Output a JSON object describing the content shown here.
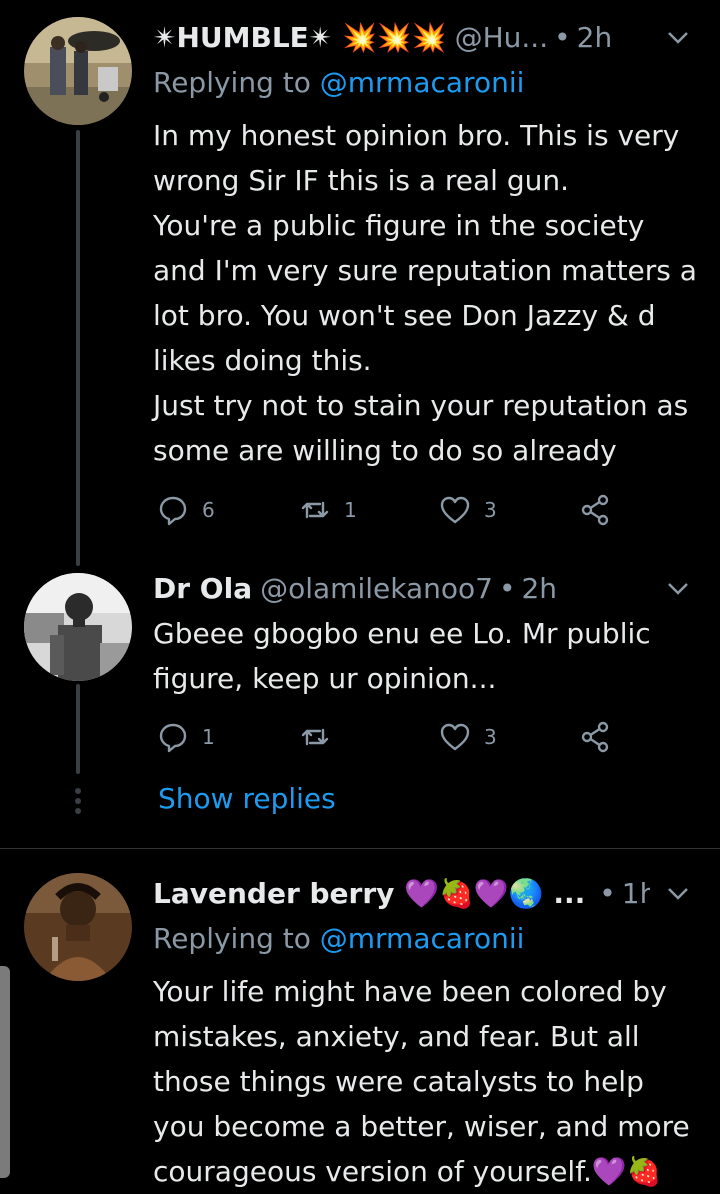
{
  "tweets": [
    {
      "name": "✴HUMBLE✴ 💥💥💥",
      "handle": "@Hu...",
      "separator": "•",
      "time": "2h",
      "replying_label": "Replying to",
      "replying_handle": "@mrmacaronii",
      "text": "In my honest opinion bro. This is very wrong Sir IF this is a real gun.\nYou're a public figure in the society and I'm very sure reputation matters a lot bro. You won't see Don Jazzy & d likes doing this.\nJust try not to stain your reputation as some are willing to do so already",
      "replies": "6",
      "retweets": "1",
      "likes": "3"
    },
    {
      "name": "Dr Ola",
      "handle": "@olamilekanoo7",
      "separator": "•",
      "time": "2h",
      "text": "Gbeee gbogbo enu ee Lo. Mr public figure, keep ur opinion...",
      "replies": "1",
      "retweets": "",
      "likes": "3"
    },
    {
      "name": "Lavender berry 💜🍓💜🌏 ...",
      "separator": "•",
      "time": "1h",
      "replying_label": "Replying to",
      "replying_handle": "@mrmacaronii",
      "text": "Your life might have been colored by mistakes, anxiety, and fear. But all those things were catalysts to help you become a better, wiser, and more courageous version of yourself.💜🍓"
    }
  ],
  "thread": {
    "show_replies": "Show replies"
  },
  "icons": {
    "reply": "reply-icon",
    "retweet": "retweet-icon",
    "like": "heart-icon",
    "share": "share-icon",
    "more": "chevron-down-icon"
  },
  "colors": {
    "background": "#000000",
    "text": "#e7e9ea",
    "muted": "#8b98a5",
    "link": "#1d9bf0",
    "divider": "#2f3336"
  }
}
